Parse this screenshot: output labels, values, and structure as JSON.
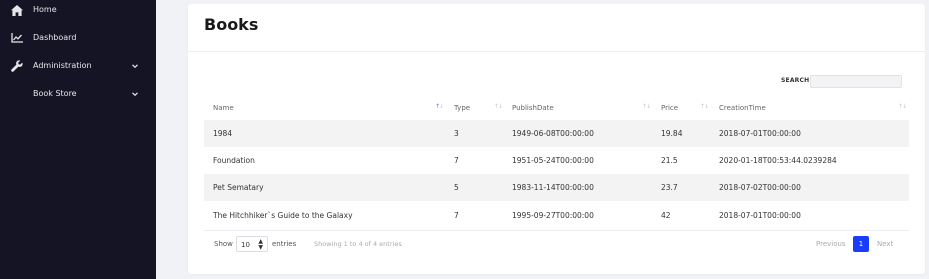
{
  "sidebar": {
    "items": [
      {
        "label": "Home",
        "icon": "home-icon"
      },
      {
        "label": "Dashboard",
        "icon": "chart-line-icon"
      },
      {
        "label": "Administration",
        "icon": "wrench-icon",
        "has_chevron": true
      },
      {
        "label": "Book Store",
        "icon": "",
        "has_chevron": true
      }
    ]
  },
  "page": {
    "title": "Books"
  },
  "search": {
    "label": "SEARCH",
    "value": "",
    "placeholder": ""
  },
  "table": {
    "columns": [
      "Name",
      "Type",
      "PublishDate",
      "Price",
      "CreationTime"
    ],
    "sorted_column": "Name",
    "sort_direction": "ascending",
    "rows": [
      [
        "1984",
        "3",
        "1949-06-08T00:00:00",
        "19.84",
        "2018-07-01T00:00:00"
      ],
      [
        "Foundation",
        "7",
        "1951-05-24T00:00:00",
        "21.5",
        "2020-01-18T00:53:44.0239284"
      ],
      [
        "Pet Sematary",
        "5",
        "1983-11-14T00:00:00",
        "23.7",
        "2018-07-02T00:00:00"
      ],
      [
        "The Hitchhiker`s Guide to the Galaxy",
        "7",
        "1995-09-27T00:00:00",
        "42",
        "2018-07-01T00:00:00"
      ]
    ]
  },
  "footer": {
    "show_label": "Show",
    "page_length": "10",
    "entries_label": "entries",
    "info": "Showing 1 to 4 of 4 entries"
  },
  "pagination": {
    "previous": "Previous",
    "current": "1",
    "next": "Next"
  },
  "colors": {
    "sidebar_bg": "#141424",
    "accent": "#1a3cff",
    "page_bg": "#f1f2f6"
  }
}
